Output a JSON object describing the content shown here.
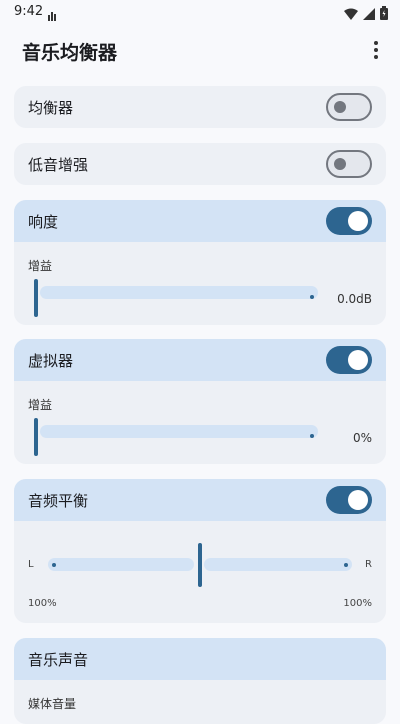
{
  "status_bar": {
    "time": "9:42",
    "icons": [
      "sim-card-icon",
      "wifi-icon",
      "signal-icon",
      "battery-icon"
    ]
  },
  "app_bar": {
    "title": "音乐均衡器",
    "menu_icon": "more-vert-icon"
  },
  "cards": {
    "equalizer": {
      "title": "均衡器",
      "enabled": false
    },
    "bass_boost": {
      "title": "低音增强",
      "enabled": false
    },
    "loudness": {
      "title": "响度",
      "enabled": true,
      "gain_label": "增益",
      "gain_value": "0.0dB",
      "gain_fraction": 0
    },
    "virtualizer": {
      "title": "虚拟器",
      "enabled": true,
      "gain_label": "增益",
      "gain_value": "0%",
      "gain_fraction": 0
    },
    "balance": {
      "title": "音频平衡",
      "enabled": true,
      "left_label": "L",
      "right_label": "R",
      "left_value": "100%",
      "right_value": "100%",
      "balance_fraction": 0.5
    },
    "music_sound": {
      "title": "音乐声音",
      "media_volume_label": "媒体音量"
    }
  },
  "colors": {
    "accent": "#2d6590",
    "card_bg": "#edf0f5",
    "active_header_bg": "#d3e3f5"
  }
}
